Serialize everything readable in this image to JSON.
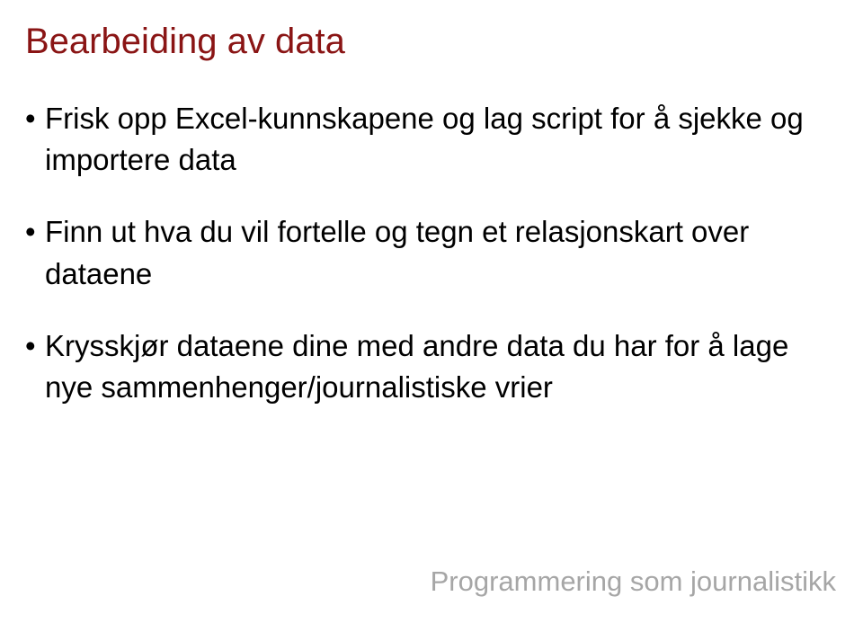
{
  "title": "Bearbeiding av data",
  "bullets": [
    "Frisk opp Excel-kunnskapene og lag script for å sjekke og importere data",
    "Finn ut hva du vil fortelle og tegn et relasjonskart over dataene",
    "Krysskjør dataene dine med andre data du har for å lage nye sammenhenger/journalistiske vrier"
  ],
  "footer": "Programmering som journalistikk"
}
